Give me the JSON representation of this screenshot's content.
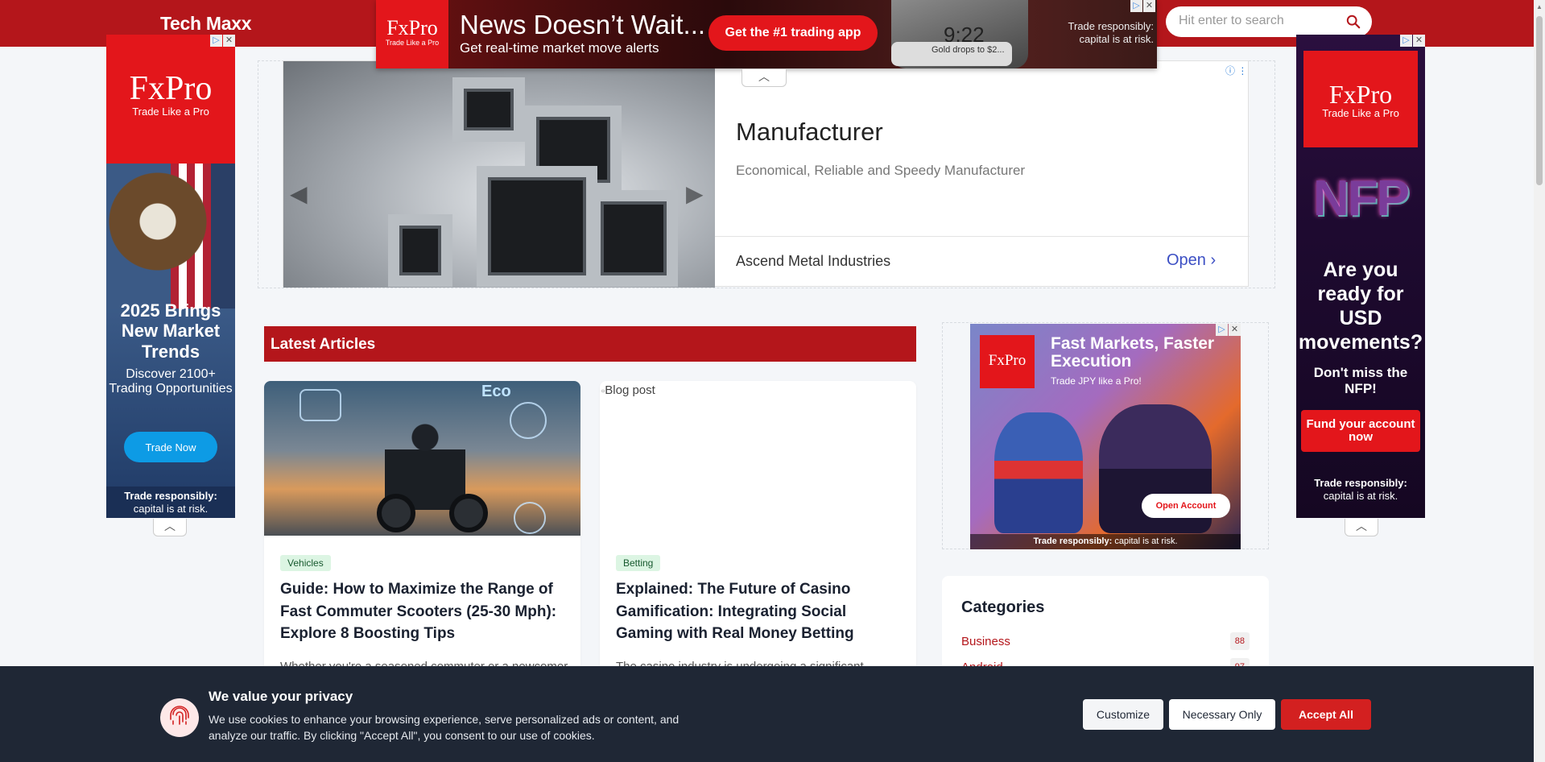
{
  "header": {
    "logo": "Tech Maxx",
    "search_placeholder": "Hit enter to search"
  },
  "top_ad": {
    "brand": "FxPro",
    "tagline": "Trade Like a Pro",
    "headline": "News Doesn’t Wait...",
    "subline": "Get real-time market move alerts",
    "cta": "Get the #1 trading app",
    "phone_time": "9:22",
    "phone_card": "Gold drops to $2...",
    "risk": "Trade responsibly: capital is at risk."
  },
  "left_ad": {
    "brand": "FxPro",
    "tagline": "Trade Like a Pro",
    "title": "2025 Brings New Market Trends",
    "subtitle": "Discover 2100+ Trading Opportunities",
    "cta": "Trade Now",
    "risk_bold": "Trade responsibly:",
    "risk": "capital is at risk."
  },
  "right_ad": {
    "brand": "FxPro",
    "tagline": "Trade Like a Pro",
    "art_text": "NFP",
    "title": "Are you ready for USD movements?",
    "subtitle": "Don't miss the NFP!",
    "cta": "Fund your account now",
    "risk_bold": "Trade responsibly:",
    "risk": "capital is at risk."
  },
  "native_ad": {
    "title": "Manufacturer",
    "description": "Economical, Reliable and Speedy Manufacturer",
    "brand": "Ascend Metal Industries",
    "open_label": "Open",
    "prev_arrow": "◀",
    "next_arrow": "▶"
  },
  "latest": {
    "section_title": "Latest Articles",
    "articles": [
      {
        "tag": "Vehicles",
        "title": "Guide: How to Maximize the Range of Fast Commuter Scooters (25-30 Mph): Explore 8 Boosting Tips",
        "excerpt": "Whether you're a seasoned commuter or a newcomer",
        "image_text": "Eco"
      },
      {
        "tag": "Betting",
        "title": "Explained: The Future of Casino Gamification: Integrating Social Gaming with Real Money Betting",
        "excerpt": "The casino industry is undergoing a significant",
        "image_alt": "Blog post"
      }
    ]
  },
  "side_ad": {
    "brand": "FxPro",
    "tagline": "Trade Like a Pro",
    "headline": "Fast Markets, Faster Execution",
    "subline": "Trade JPY like a Pro!",
    "cta": "Open Account",
    "risk_bold": "Trade responsibly:",
    "risk": "capital is at risk."
  },
  "categories": {
    "title": "Categories",
    "items": [
      {
        "name": "Business",
        "count": "88"
      },
      {
        "name": "Android",
        "count": "97"
      }
    ]
  },
  "cookie": {
    "title": "We value your privacy",
    "text": "We use cookies to enhance your browsing experience, serve personalized ads or content, and analyze our traffic. By clicking \"Accept All\", you consent to our use of cookies.",
    "customize": "Customize",
    "necessary": "Necessary Only",
    "accept": "Accept All"
  },
  "colors": {
    "brand_red": "#b4161b",
    "fxpro_red": "#e3161b",
    "cookie_bg": "#1f2735",
    "link_blue": "#3c4fc4"
  },
  "icons": [
    "search-icon",
    "fingerprint-icon",
    "chevron-up-icon",
    "close-icon",
    "adchoices-icon",
    "chevron-right-icon",
    "chevron-left-icon"
  ]
}
